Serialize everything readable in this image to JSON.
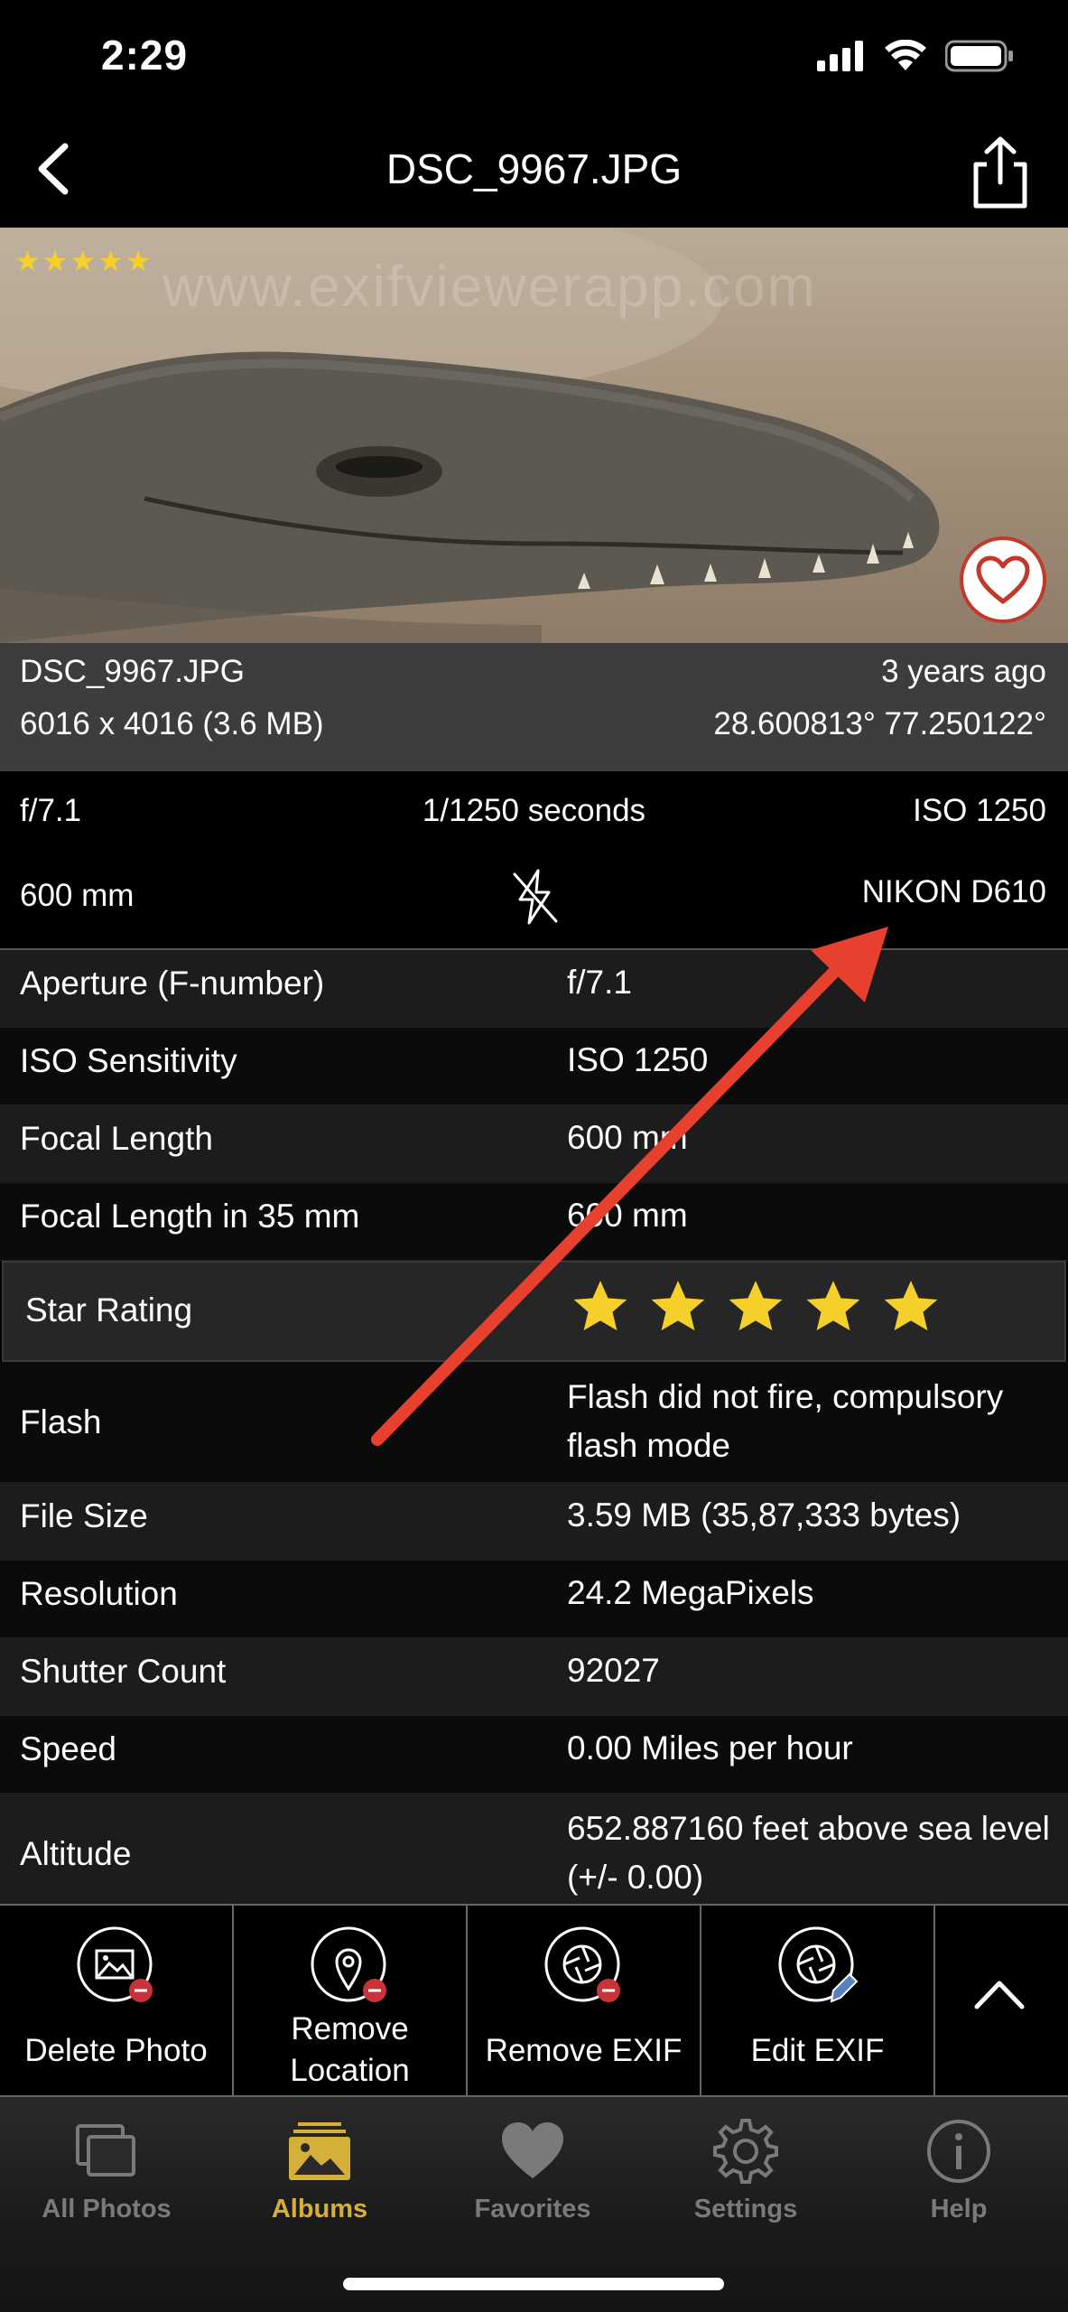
{
  "status": {
    "time": "2:29"
  },
  "nav": {
    "title": "DSC_9967.JPG"
  },
  "photo": {
    "watermark": "www.exifviewerapp.com",
    "star_rating": 5
  },
  "photo_info": {
    "filename": "DSC_9967.JPG",
    "age": "3 years ago",
    "dimensions": "6016 x 4016 (3.6 MB)",
    "gps": "28.600813° 77.250122°"
  },
  "summary": {
    "aperture": "f/7.1",
    "shutter": "1/1250 seconds",
    "iso": "ISO 1250",
    "focal": "600 mm",
    "camera": "NIKON D610"
  },
  "details": [
    {
      "label": "Aperture (F-number)",
      "value": "f/7.1"
    },
    {
      "label": "ISO Sensitivity",
      "value": "ISO 1250"
    },
    {
      "label": "Focal Length",
      "value": "600 mm"
    },
    {
      "label": "Focal Length in 35 mm",
      "value": "600 mm"
    },
    {
      "label": "Star Rating",
      "value": ""
    },
    {
      "label": "Flash",
      "value": "Flash did not fire, compulsory flash mode"
    },
    {
      "label": "File Size",
      "value": "3.59 MB (35,87,333 bytes)"
    },
    {
      "label": "Resolution",
      "value": "24.2 MegaPixels"
    },
    {
      "label": "Shutter Count",
      "value": "92027"
    },
    {
      "label": "Speed",
      "value": "0.00 Miles per hour"
    },
    {
      "label": "Altitude",
      "value": "652.887160 feet above sea level (+/- 0.00)"
    }
  ],
  "star_rating_value": 5,
  "actions": {
    "delete_photo": "Delete Photo",
    "remove_location_line1": "Remove",
    "remove_location_line2": "Location",
    "remove_exif": "Remove EXIF",
    "edit_exif": "Edit EXIF"
  },
  "tabs": [
    {
      "label": "All Photos",
      "icon": "photos-icon",
      "active": false
    },
    {
      "label": "Albums",
      "icon": "albums-icon",
      "active": true
    },
    {
      "label": "Favorites",
      "icon": "heart-icon",
      "active": false
    },
    {
      "label": "Settings",
      "icon": "gear-icon",
      "active": false
    },
    {
      "label": "Help",
      "icon": "info-icon",
      "active": false
    }
  ],
  "colors": {
    "accent": "#d4b03a",
    "star": "#f5d02a",
    "arrow": "#e8402f",
    "badge": "#c8333a"
  }
}
